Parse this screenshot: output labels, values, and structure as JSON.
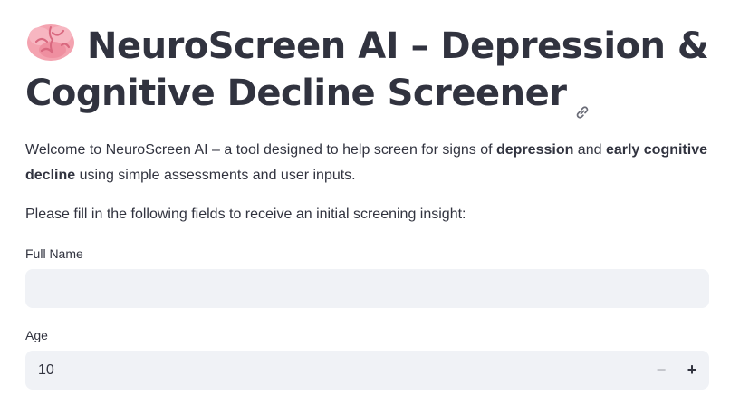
{
  "header": {
    "title": "NeuroScreen AI – Depression & Cognitive Decline Screener",
    "title_icon": "brain-emoji",
    "anchor_icon": "link-icon"
  },
  "intro": {
    "prefix": "Welcome to NeuroScreen AI – a tool designed to help screen for signs of ",
    "bold1": "depression",
    "middle": " and ",
    "bold2": "early cognitive decline",
    "suffix": " using simple assessments and user inputs."
  },
  "instructions": "Please fill in the following fields to receive an initial screening insight:",
  "form": {
    "full_name": {
      "label": "Full Name",
      "value": "",
      "placeholder": ""
    },
    "age": {
      "label": "Age",
      "value": "10",
      "decrement_label": "−",
      "increment_label": "+"
    }
  },
  "colors": {
    "text": "#31333f",
    "input_bg": "#f0f2f6",
    "brain_pink": "#f4a3b0",
    "disabled": "#c4c6cc"
  }
}
